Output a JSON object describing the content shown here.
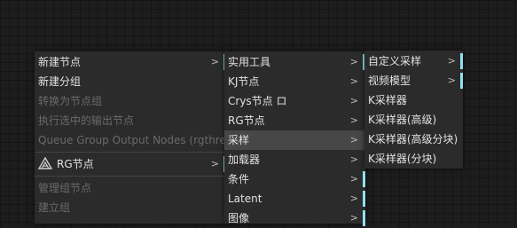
{
  "colors": {
    "accent": "#8ee0ef",
    "menu_bg": "#2b2b2b",
    "active_bg": "#474747"
  },
  "menu1": {
    "new_node": "新建节点",
    "new_group": "新建分组",
    "convert_group": "转换为节点组",
    "exec_selected": "执行选中的输出节点",
    "queue_group": "Queue Group Output Nodes (rgthree)",
    "rg_nodes": "RG节点",
    "manage_group": "管理组节点",
    "build_group": "建立组"
  },
  "menu2": {
    "items": [
      "实用工具",
      "KJ节点",
      "Crys节点 ロ",
      "RG节点",
      "采样",
      "加载器",
      "条件",
      "Latent",
      "图像"
    ]
  },
  "menu3": {
    "items": [
      "自定义采样",
      "视频模型",
      "K采样器",
      "K采样器(高级)",
      "K采样器(高级分块)",
      "K采样器(分块)"
    ]
  },
  "arrow_icon": "chevron-right-icon"
}
